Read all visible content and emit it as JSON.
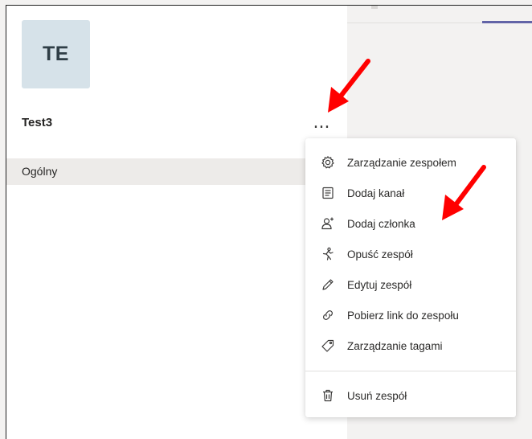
{
  "team": {
    "avatar_initials": "TE",
    "name": "Test3",
    "more_label": "..."
  },
  "channels": [
    {
      "label": "Ogólny"
    }
  ],
  "menu": {
    "items": [
      {
        "label": "Zarządzanie zespołem",
        "icon": "gear-icon"
      },
      {
        "label": "Dodaj kanał",
        "icon": "channel-list-icon"
      },
      {
        "label": "Dodaj członka",
        "icon": "add-member-icon"
      },
      {
        "label": "Opuść zespół",
        "icon": "leave-person-icon"
      },
      {
        "label": "Edytuj zespół",
        "icon": "pencil-icon"
      },
      {
        "label": "Pobierz link do zespołu",
        "icon": "link-icon"
      },
      {
        "label": "Zarządzanie tagami",
        "icon": "tag-icon"
      }
    ],
    "danger_items": [
      {
        "label": "Usuń zespół",
        "icon": "trash-icon"
      }
    ]
  },
  "colors": {
    "accent": "#6264a7",
    "annotation_arrow": "#ff0000",
    "avatar_bg": "#d6e2e9",
    "selected_channel_bg": "#edebe9"
  }
}
